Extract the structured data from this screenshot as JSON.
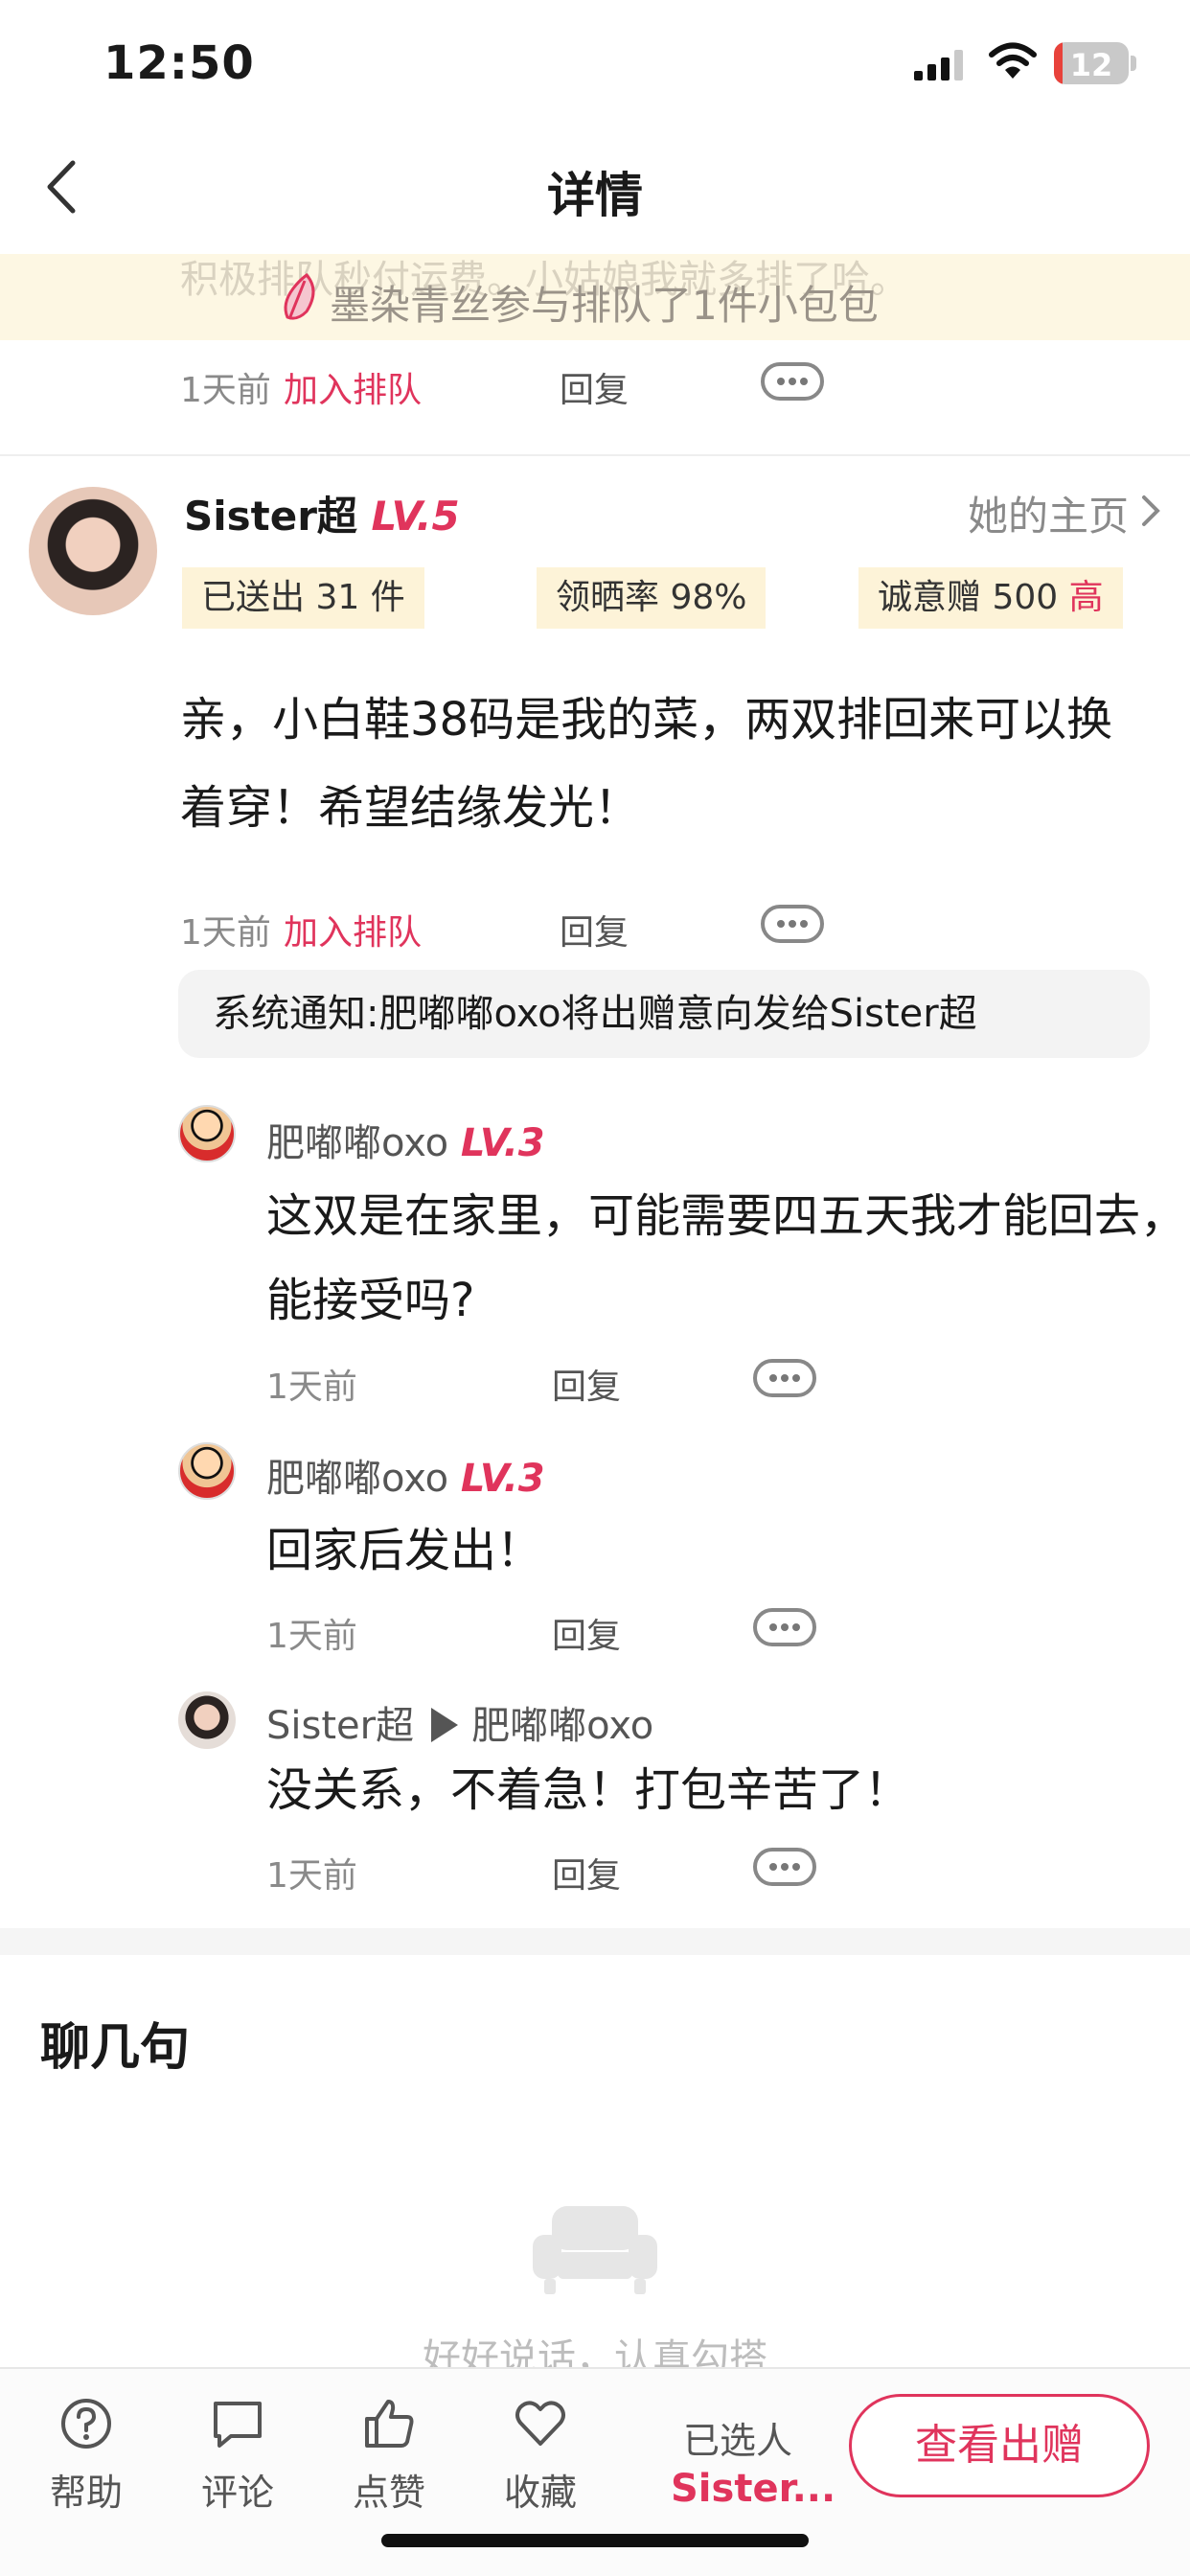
{
  "status_bar": {
    "time": "12:50",
    "battery": "12",
    "battery_level": 0.12
  },
  "header": {
    "title": "详情"
  },
  "banner": {
    "ghost_text": "积极排队秒付运费。小姑娘我就多排了哈。",
    "text": "墨染青丝参与排队了1件小包包"
  },
  "prev_comment_meta": {
    "time": "1天前",
    "join": "加入排队",
    "reply": "回复"
  },
  "main_comment": {
    "username": "Sister超",
    "level": "LV.5",
    "homepage": "她的主页",
    "stats": {
      "sent": "已送出 31 件",
      "sun_rate": "领晒率 98%",
      "sincerity": "诚意赠 500",
      "sincerity_tag": "高"
    },
    "body": "亲，小白鞋38码是我的菜，两双排回来可以换着穿！希望结缘发光！",
    "time": "1天前",
    "join": "加入排队",
    "reply": "回复",
    "system_notice": "系统通知:肥嘟嘟oxo将出赠意向发给Sister超"
  },
  "replies": [
    {
      "name": "肥嘟嘟oxo",
      "level": "LV.3",
      "text": "这双是在家里，可能需要四五天我才能回去，能接受吗?",
      "time": "1天前",
      "reply": "回复"
    },
    {
      "name": "肥嘟嘟oxo",
      "level": "LV.3",
      "text": "回家后发出！",
      "time": "1天前",
      "reply": "回复"
    },
    {
      "name": "Sister超",
      "to": "肥嘟嘟oxo",
      "text": "没关系，不着急！打包辛苦了！",
      "time": "1天前",
      "reply": "回复"
    }
  ],
  "chat": {
    "title": "聊几句",
    "empty_text": "好好说话，认真勾搭",
    "empty_icon": "sofa-icon"
  },
  "bottom_bar": {
    "tabs": [
      {
        "label": "帮助",
        "icon": "help-icon"
      },
      {
        "label": "评论",
        "icon": "comment-icon"
      },
      {
        "label": "点赞",
        "icon": "thumbs-up-icon"
      },
      {
        "label": "收藏",
        "icon": "heart-icon"
      }
    ],
    "selected_label": "已选人",
    "selected_name": "Sister...",
    "view_button": "查看出赠"
  },
  "colors": {
    "accent": "#e0345c",
    "stat_bg": "#fdf3d8",
    "banner_bg": "#fdf7e3",
    "notice_bg": "#f3f3f3"
  }
}
